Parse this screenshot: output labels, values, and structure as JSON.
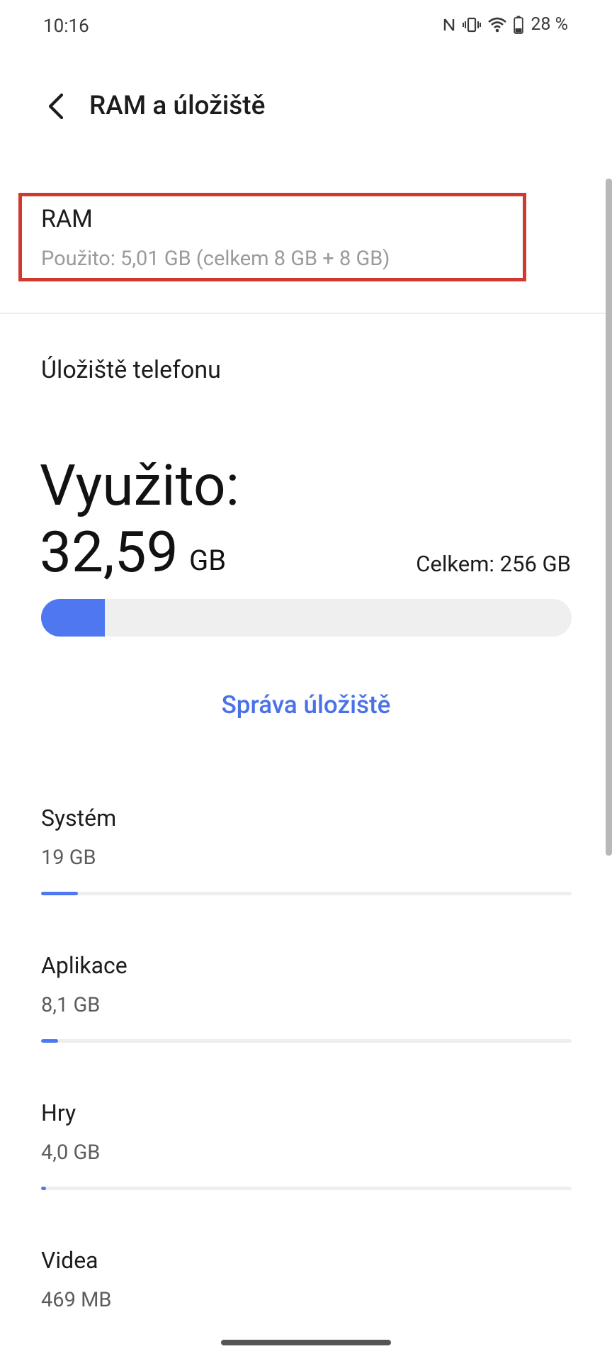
{
  "status_bar": {
    "time": "10:16",
    "battery_percent": "28 %",
    "icons": [
      "nfc-icon",
      "vibrate-icon",
      "wifi-icon",
      "battery-icon"
    ]
  },
  "header": {
    "title": "RAM a úložiště",
    "back_icon": "back-arrow-icon"
  },
  "ram": {
    "title": "RAM",
    "summary": "Použito: 5,01 GB (celkem 8 GB + 8 GB)"
  },
  "storage": {
    "section_title": "Úložiště telefonu",
    "used_label": "Využito:",
    "used_value": "32,59",
    "used_unit": "GB",
    "total_label": "Celkem: 256 GB",
    "used_fraction": 0.12,
    "manage_label": "Správa úložiště"
  },
  "categories": [
    {
      "name": "Systém",
      "size": "19 GB",
      "fraction": 0.07
    },
    {
      "name": "Aplikace",
      "size": "8,1 GB",
      "fraction": 0.032
    },
    {
      "name": "Hry",
      "size": "4,0 GB",
      "fraction": 0.01
    },
    {
      "name": "Videa",
      "size": "469 MB",
      "fraction": null
    }
  ],
  "colors": {
    "accent": "#4f78f0",
    "link": "#4a72e8",
    "highlight_border": "#d0392f",
    "track": "#efefef"
  }
}
